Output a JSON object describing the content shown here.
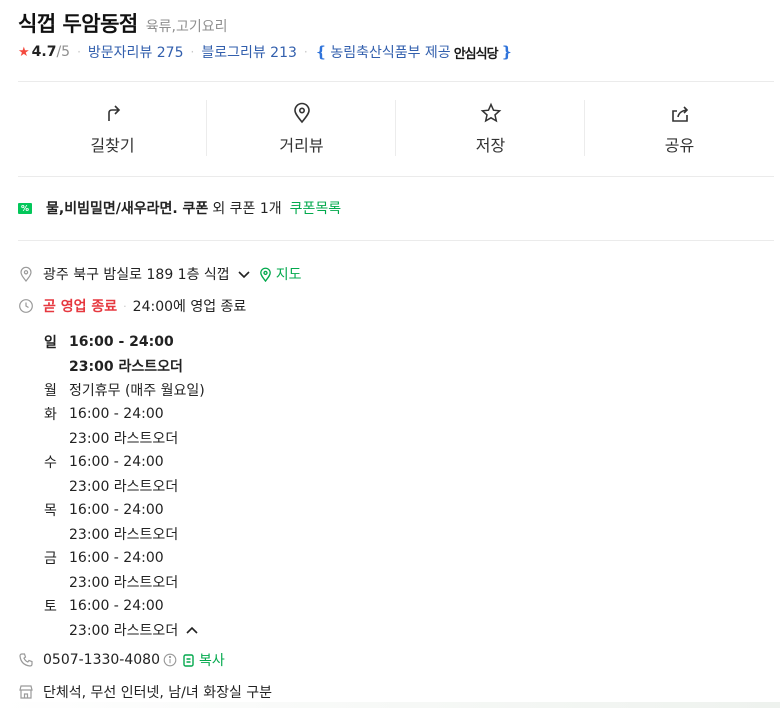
{
  "place": {
    "name": "식껍 두암동점",
    "category": "육류,고기요리",
    "rating": "4.7",
    "rating_max": "/5",
    "visitor_reviews": "방문자리뷰 275",
    "blog_reviews": "블로그리뷰 213",
    "certified_by": "농림축산식품부 제공",
    "certified_badge": "안심식당"
  },
  "actions": [
    {
      "label": "길찾기",
      "icon": "directions-icon"
    },
    {
      "label": "거리뷰",
      "icon": "location-pin-icon"
    },
    {
      "label": "저장",
      "icon": "star-icon"
    },
    {
      "label": "공유",
      "icon": "share-icon"
    }
  ],
  "coupon": {
    "bold_text": "물,비빔밀면/새우라면. 쿠폰",
    "extra_text": "외 쿠폰 1개",
    "link": "쿠폰목록"
  },
  "address": {
    "text": "광주 북구 밤실로 189 1층 식껍",
    "map_link": "지도"
  },
  "status": {
    "state": "곧 영업 종료",
    "detail": "24:00에 영업 종료"
  },
  "hours": [
    {
      "day": "일",
      "time": "16:00 - 24:00",
      "note": "23:00 라스트오더"
    },
    {
      "day": "월",
      "time": "정기휴무 (매주 월요일)",
      "note": ""
    },
    {
      "day": "화",
      "time": "16:00 - 24:00",
      "note": "23:00 라스트오더"
    },
    {
      "day": "수",
      "time": "16:00 - 24:00",
      "note": "23:00 라스트오더"
    },
    {
      "day": "목",
      "time": "16:00 - 24:00",
      "note": "23:00 라스트오더"
    },
    {
      "day": "금",
      "time": "16:00 - 24:00",
      "note": "23:00 라스트오더"
    },
    {
      "day": "토",
      "time": "16:00 - 24:00",
      "note": "23:00 라스트오더"
    }
  ],
  "phone": {
    "number": "0507-1330-4080",
    "copy_label": "복사"
  },
  "amenities": "단체석, 무선 인터넷, 남/녀 화장실 구분",
  "colors": {
    "green": "#03a94d",
    "link_blue": "#325fad",
    "closing_red": "#e6383f",
    "star_red": "#f44a3f"
  }
}
